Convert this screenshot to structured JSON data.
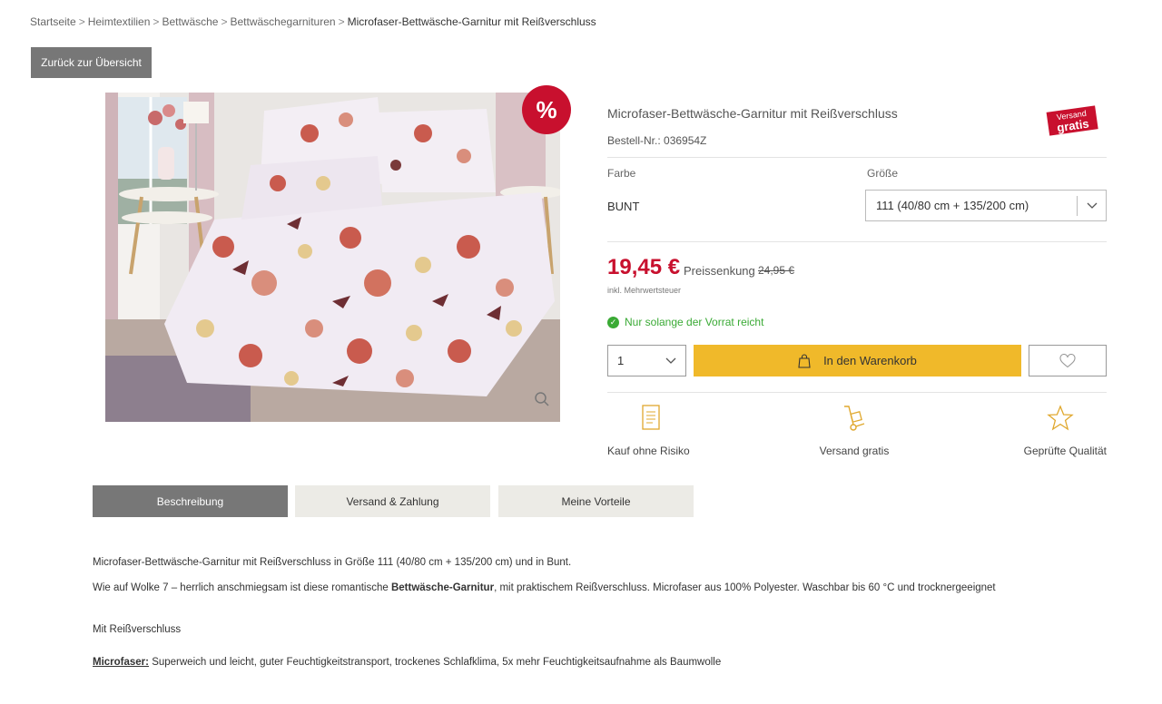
{
  "breadcrumb": {
    "items": [
      "Startseite",
      "Heimtextilien",
      "Bettwäsche",
      "Bettwäschegarnituren"
    ],
    "current": "Microfaser-Bettwäsche-Garnitur mit Reißverschluss",
    "separator": ">"
  },
  "back_button": "Zurück zur Übersicht",
  "sale_badge": "%",
  "product": {
    "title": "Microfaser-Bettwäsche-Garnitur mit Reißverschluss",
    "order_number": "Bestell-Nr.: 036954Z",
    "shipping_logo": {
      "line1": "Versand",
      "line2": "gratis"
    },
    "color_label": "Farbe",
    "color_value": "BUNT",
    "size_label": "Größe",
    "size_value": "111 (40/80 cm + 135/200 cm)",
    "price": "19,45 €",
    "price_note": "Preissenkung",
    "old_price": "24,95 €",
    "tax_note": "inkl. Mehrwertsteuer",
    "stock_text": "Nur solange der Vorrat reicht",
    "quantity": "1",
    "cart_button": "In den Warenkorb"
  },
  "features": [
    {
      "label": "Kauf ohne Risiko",
      "icon": "document-icon"
    },
    {
      "label": "Versand gratis",
      "icon": "hand-truck-icon"
    },
    {
      "label": "Geprüfte Qualität",
      "icon": "star-icon"
    }
  ],
  "tabs": [
    {
      "label": "Beschreibung",
      "active": true
    },
    {
      "label": "Versand & Zahlung",
      "active": false
    },
    {
      "label": "Meine Vorteile",
      "active": false
    }
  ],
  "description": {
    "intro": "Microfaser-Bettwäsche-Garnitur mit Reißverschluss in Größe 111 (40/80 cm + 135/200 cm) und in Bunt.",
    "body_pre": "Wie auf Wolke 7 – herrlich anschmiegsam ist diese romantische ",
    "body_bold": "Bettwäsche-Garnitur",
    "body_post": ", mit praktischem Reißverschluss. Microfaser aus 100% Polyester. Waschbar bis 60 °C und trocknergeeignet",
    "heading": "Mit Reißverschluss",
    "material_label": "Microfaser:",
    "material_text": " Superweich und leicht, guter Feuchtigkeitstransport, trockenes Schlafklima, 5x mehr Feuchtigkeitsaufnahme als Baumwolle"
  },
  "colors": {
    "accent_red": "#c8102e",
    "cart_yellow": "#f0b92a",
    "stock_green": "#3aaa35",
    "tab_active": "#777777",
    "tab_inactive": "#ecebe6"
  }
}
